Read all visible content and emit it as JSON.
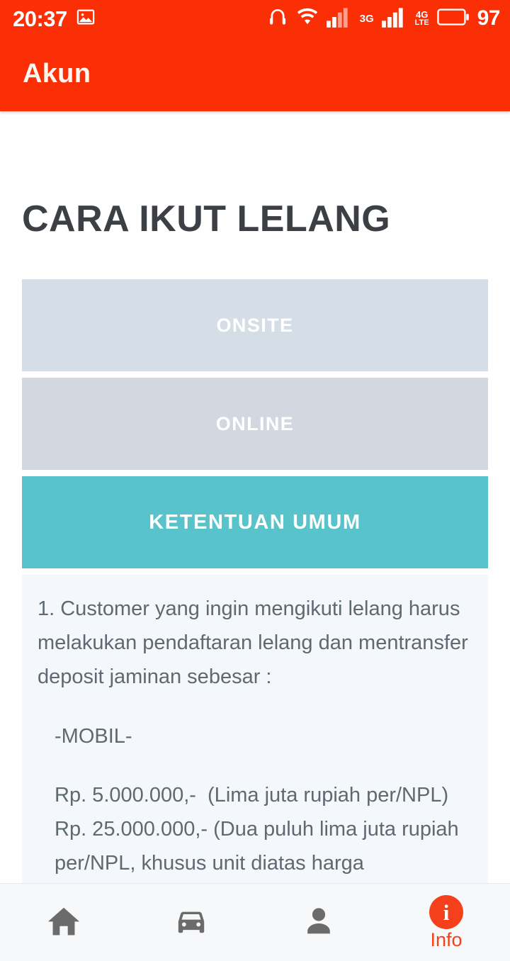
{
  "status_bar": {
    "time": "20:37",
    "battery_percent": "97",
    "network_3g": "3G",
    "network_lte_top": "4G",
    "network_lte_bottom": "LTE",
    "icons": [
      "image-icon",
      "headphones-icon",
      "wifi-icon",
      "signal-bars-icon",
      "signal-bars-icon",
      "battery-icon"
    ],
    "background_color": "#fa2f05"
  },
  "app_bar": {
    "title": "Akun",
    "background_color": "#fa2f05",
    "text_color": "#fdf6f1"
  },
  "main": {
    "heading": "CARA IKUT LELANG",
    "heading_color": "#3c4044",
    "tabs": [
      {
        "label": "ONSITE",
        "active": false,
        "color": "#d5dee6"
      },
      {
        "label": "ONLINE",
        "active": false,
        "color": "#d2d7e0"
      },
      {
        "label": "KETENTUAN UMUM",
        "active": true,
        "color": "#59c3cc"
      }
    ],
    "panel": {
      "background_color": "#f4f7fb",
      "text_color": "#5e6972",
      "paragraph_1": "1. Customer yang ingin mengikuti lelang harus melakukan pendaftaran lelang dan mentransfer deposit jaminan sebesar :",
      "subheading": "-MOBIL-",
      "price_1": "Rp. 5.000.000,-  (Lima juta rupiah per/NPL)",
      "price_2": "Rp. 25.000.000,- (Dua puluh lima juta rupiah per/NPL, khusus unit diatas harga"
    }
  },
  "bottom_nav": {
    "active_color": "#f4411c",
    "inactive_color": "#6b6b6b",
    "background_color": "#f7f8f9",
    "items": [
      {
        "icon": "home-icon",
        "label": "",
        "active": false
      },
      {
        "icon": "car-icon",
        "label": "",
        "active": false
      },
      {
        "icon": "person-icon",
        "label": "",
        "active": false
      },
      {
        "icon": "info-icon",
        "label": "Info",
        "active": true
      }
    ]
  }
}
